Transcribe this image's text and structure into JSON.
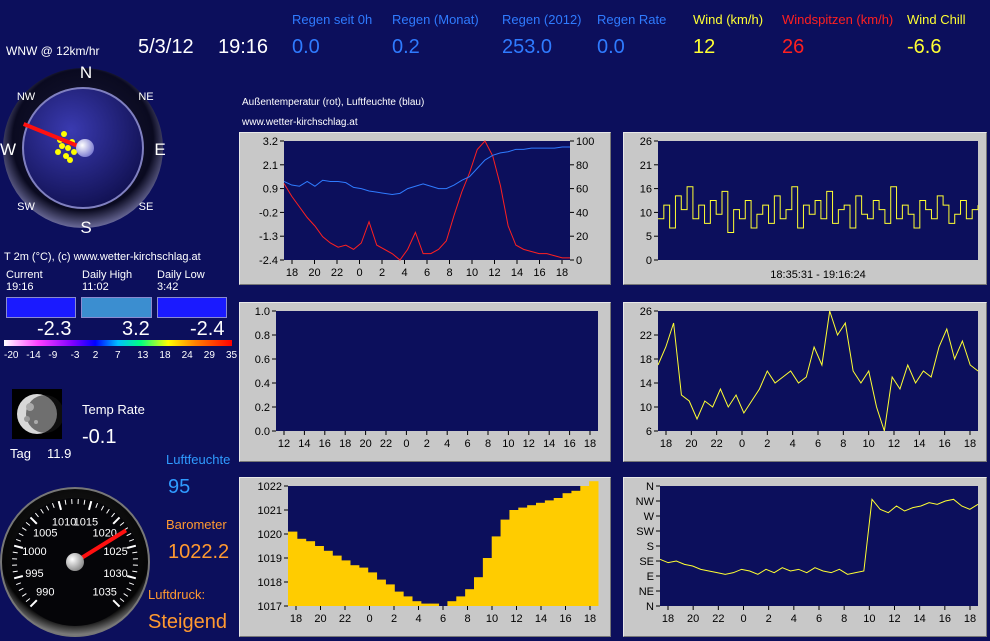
{
  "header": {
    "wind_dir": "WNW @ 12km/hr",
    "date": "5/3/12",
    "time": "19:16",
    "stats": [
      {
        "label": "Regen seit 0h",
        "value": "0.0",
        "color": "#2f7bff"
      },
      {
        "label": "Regen (Monat)",
        "value": "0.2",
        "color": "#2f7bff"
      },
      {
        "label": "Regen (2012)",
        "value": "253.0",
        "color": "#2f7bff"
      },
      {
        "label": "Regen Rate",
        "value": "0.0",
        "color": "#2f7bff"
      },
      {
        "label": "Wind (km/h)",
        "value": "12",
        "color": "#ffff33"
      },
      {
        "label": "Windspitzen (km/h)",
        "value": "26",
        "color": "#ff2020"
      },
      {
        "label": "Wind Chill",
        "value": "-6.6",
        "color": "#ffff33"
      }
    ]
  },
  "compass": {
    "n": "N",
    "s": "S",
    "e": "E",
    "w": "W",
    "nw": "NW",
    "ne": "NE",
    "sw": "SW",
    "se": "SE",
    "needle_deg": 292
  },
  "temperature": {
    "caption": "T 2m (°C), (c) www.wetter-kirchschlag.at",
    "current_label": "Current",
    "current_time": "19:16",
    "current_value": "-2.3",
    "high_label": "Daily High",
    "high_time": "11:02",
    "high_value": "3.2",
    "low_label": "Daily Low",
    "low_time": "3:42",
    "low_value": "-2.4",
    "scale": [
      "-20",
      "-14",
      "-9",
      "-3",
      "2",
      "7",
      "13",
      "18",
      "24",
      "29",
      "35"
    ]
  },
  "moon": {
    "label": "Tag",
    "value": "11.9"
  },
  "temp_rate": {
    "label": "Temp Rate",
    "value": "-0.1"
  },
  "humidity": {
    "label": "Luftfeuchte",
    "value": "95"
  },
  "barometer": {
    "label": "Barometer",
    "value": "1022.2",
    "trend_label": "Luftdruck:",
    "trend_value": "Steigend",
    "dial": [
      "990",
      "995",
      "1000",
      "1005",
      "1010",
      "1015",
      "1020",
      "1025",
      "1030",
      "1035"
    ],
    "pressure": 1022.2
  },
  "chart_titles": {
    "temp_chart": "Außentemperatur (rot), Luftfeuchte (blau)",
    "site": "www.wetter-kirchschlag.at"
  },
  "wind_range": "18:35:31  -  19:16:24",
  "chart_data": [
    {
      "type": "line",
      "title": "Außentemperatur (rot), Luftfeuchte (blau)",
      "x_ticks": [
        "18",
        "20",
        "22",
        "0",
        "2",
        "4",
        "6",
        "8",
        "10",
        "12",
        "14",
        "16",
        "18"
      ],
      "y_ticks": [
        "3.2",
        "2.1",
        "0.9",
        "-0.2",
        "-1.3",
        "-2.4"
      ],
      "y2_ticks": [
        "100",
        "80",
        "60",
        "40",
        "20",
        "0"
      ],
      "ylim": [
        -2.4,
        3.2
      ],
      "y2lim": [
        0,
        100
      ],
      "series": [
        {
          "name": "Außentemperatur",
          "color": "#ff2020",
          "values": [
            1.2,
            0.6,
            0.1,
            -0.4,
            -0.8,
            -1.3,
            -1.6,
            -1.8,
            -1.7,
            -1.9,
            -1.6,
            -0.6,
            -1.7,
            -1.9,
            -2.1,
            -2.4,
            -1.9,
            -1.1,
            -2.1,
            -2.1,
            -1.9,
            -1.5,
            -0.3,
            0.8,
            1.7,
            2.8,
            3.2,
            2.5,
            1.1,
            -0.8,
            -1.7,
            -1.9,
            -2.0,
            -2.1,
            -2.1,
            -2.2,
            -2.3,
            -2.3
          ]
        },
        {
          "name": "Luftfeuchte",
          "color": "#2f7bff",
          "values": [
            66,
            63,
            62,
            66,
            62,
            67,
            66,
            66,
            65,
            61,
            60,
            58,
            57,
            56,
            55,
            56,
            60,
            62,
            64,
            62,
            60,
            60,
            63,
            67,
            70,
            77,
            84,
            88,
            90,
            91,
            93,
            93,
            94,
            94,
            94,
            94,
            95,
            95
          ]
        }
      ]
    },
    {
      "type": "line",
      "title": "",
      "x_ticks": [
        "18:35:31",
        "19:16:24"
      ],
      "y_ticks": [
        "26",
        "21",
        "16",
        "10",
        "5",
        "0"
      ],
      "ylim": [
        0,
        26
      ],
      "series": [
        {
          "name": "",
          "color": "#ffff33",
          "values": [
            9,
            12,
            7,
            14,
            11,
            16,
            9,
            12,
            8,
            13,
            10,
            15,
            6,
            11,
            9,
            13,
            7,
            10,
            12,
            8,
            14,
            9,
            11,
            16,
            7,
            12,
            10,
            13,
            9,
            15,
            8,
            11,
            12,
            7,
            14,
            10,
            9,
            13,
            11,
            8,
            16,
            9,
            12,
            10,
            7,
            13,
            11,
            9,
            14,
            12,
            8,
            10,
            13,
            9,
            11,
            12
          ]
        }
      ]
    },
    {
      "type": "line",
      "title": "",
      "x_ticks": [
        "12",
        "14",
        "16",
        "18",
        "20",
        "22",
        "0",
        "2",
        "4",
        "6",
        "8",
        "10",
        "12",
        "14",
        "16",
        "18"
      ],
      "y_ticks": [
        "1.0",
        "0.8",
        "0.6",
        "0.4",
        "0.2",
        "0.0"
      ],
      "ylim": [
        0,
        1
      ],
      "series": []
    },
    {
      "type": "line",
      "title": "",
      "x_ticks": [
        "18",
        "20",
        "22",
        "0",
        "2",
        "4",
        "6",
        "8",
        "10",
        "12",
        "14",
        "16",
        "18"
      ],
      "y_ticks": [
        "26",
        "22",
        "18",
        "14",
        "10",
        "6"
      ],
      "ylim": [
        6,
        26
      ],
      "series": [
        {
          "name": "",
          "color": "#ffff33",
          "values": [
            17,
            20,
            24,
            12,
            11,
            8,
            11,
            10,
            13,
            10,
            12,
            9,
            11,
            13,
            16,
            14,
            15,
            16,
            14,
            15,
            20,
            17,
            26,
            22,
            24,
            16,
            14,
            16,
            10,
            6,
            15,
            13,
            17,
            14,
            16,
            15,
            20,
            23,
            18,
            21,
            17,
            16
          ]
        }
      ]
    },
    {
      "type": "area",
      "title": "",
      "x_ticks": [
        "18",
        "20",
        "22",
        "0",
        "2",
        "4",
        "6",
        "8",
        "10",
        "12",
        "14",
        "16",
        "18"
      ],
      "y_ticks": [
        "1022",
        "1021",
        "1020",
        "1019",
        "1018",
        "1017"
      ],
      "ylim": [
        1017,
        1022
      ],
      "series": [
        {
          "name": "",
          "color": "#ffcc00",
          "values": [
            1020.1,
            1019.8,
            1019.7,
            1019.5,
            1019.3,
            1019.1,
            1018.9,
            1018.7,
            1018.6,
            1018.4,
            1018.1,
            1017.9,
            1017.6,
            1017.4,
            1017.2,
            1017.1,
            1017.1,
            1017.0,
            1017.2,
            1017.4,
            1017.7,
            1018.2,
            1019.0,
            1019.9,
            1020.6,
            1021.0,
            1021.1,
            1021.2,
            1021.3,
            1021.4,
            1021.5,
            1021.7,
            1021.8,
            1022.0,
            1022.2
          ]
        }
      ]
    },
    {
      "type": "line",
      "title": "",
      "x_ticks": [
        "18",
        "20",
        "22",
        "0",
        "2",
        "4",
        "6",
        "8",
        "10",
        "12",
        "14",
        "16",
        "18"
      ],
      "y_ticks": [
        "N",
        "NW",
        "W",
        "SW",
        "S",
        "SE",
        "E",
        "NE",
        "N"
      ],
      "ylim": [
        0,
        360
      ],
      "series": [
        {
          "name": "",
          "color": "#ffff33",
          "values": [
            140,
            130,
            135,
            125,
            120,
            110,
            105,
            100,
            95,
            100,
            110,
            105,
            95,
            110,
            100,
            115,
            105,
            110,
            100,
            115,
            105,
            100,
            110,
            95,
            100,
            105,
            320,
            290,
            280,
            300,
            285,
            295,
            300,
            310,
            305,
            315,
            320,
            300,
            290,
            305
          ]
        }
      ]
    }
  ]
}
